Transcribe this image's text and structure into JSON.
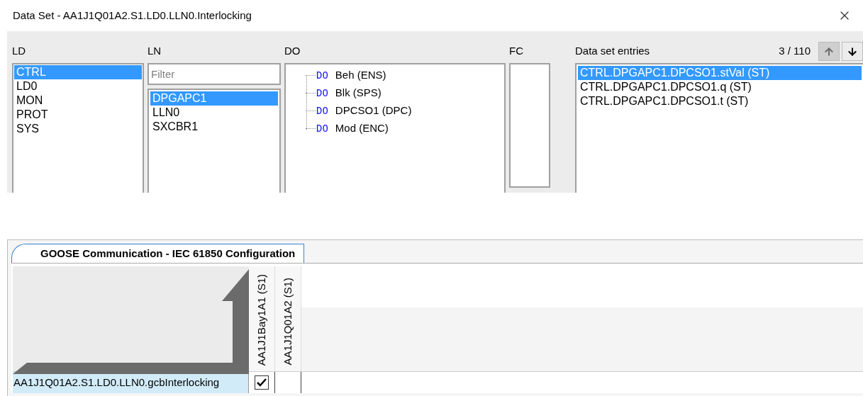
{
  "window": {
    "title": "Data Set - AA1J1Q01A2.S1.LD0.LLN0.Interlocking"
  },
  "ld": {
    "label": "LD",
    "items": [
      {
        "label": "CTRL",
        "selected": true
      },
      {
        "label": "LD0",
        "selected": false
      },
      {
        "label": "MON",
        "selected": false
      },
      {
        "label": "PROT",
        "selected": false
      },
      {
        "label": "SYS",
        "selected": false
      }
    ]
  },
  "ln": {
    "label": "LN",
    "filter": {
      "placeholder": "Filter"
    },
    "items": [
      {
        "label": "DPGAPC1",
        "selected": true
      },
      {
        "label": "LLN0",
        "selected": false
      },
      {
        "label": "SXCBR1",
        "selected": false
      }
    ]
  },
  "do": {
    "label": "DO",
    "items": [
      {
        "tag": "DO",
        "label": "Beh (ENS)"
      },
      {
        "tag": "DO",
        "label": "Blk (SPS)"
      },
      {
        "tag": "DO",
        "label": "DPCSO1 (DPC)"
      },
      {
        "tag": "DO",
        "label": "Mod (ENC)"
      }
    ]
  },
  "fc": {
    "label": "FC"
  },
  "entries": {
    "label": "Data set entries",
    "counter": "3 / 110",
    "buttons": [
      {
        "kind": "up",
        "disabled": true
      },
      {
        "kind": "down",
        "disabled": false
      }
    ],
    "items": [
      {
        "label": "CTRL.DPGAPC1.DPCSO1.stVal (ST)",
        "selected": true
      },
      {
        "label": "CTRL.DPGAPC1.DPCSO1.q (ST)",
        "selected": false
      },
      {
        "label": "CTRL.DPGAPC1.DPCSO1.t (ST)",
        "selected": false
      }
    ]
  },
  "goose": {
    "tabs": [
      {
        "label": "GOOSE Communication - IEC 61850 Configuration",
        "selected": true
      }
    ],
    "columns": [
      "AA1J1Bay1A1 (S1)",
      "AA1J1Q01A2 (S1)"
    ],
    "rows": [
      {
        "label": "AA1J1Q01A2.S1.LD0.LLN0.gcbInterlocking",
        "selected": true,
        "cells": [
          {
            "checked": true
          },
          {
            "checked": false
          }
        ]
      }
    ]
  }
}
